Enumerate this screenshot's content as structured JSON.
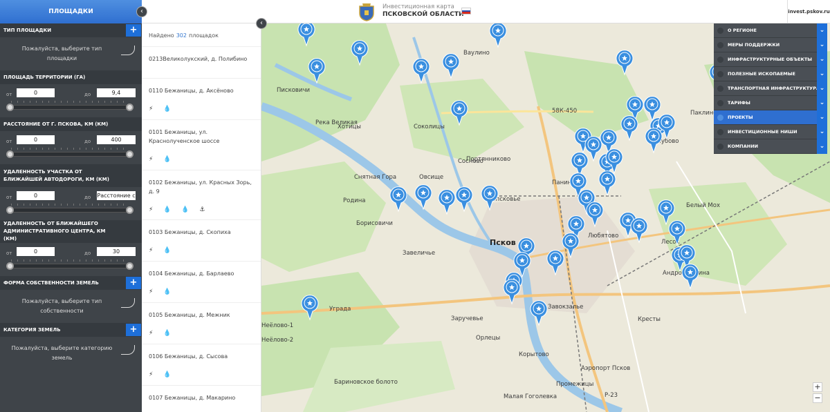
{
  "sidebar": {
    "title": "ПЛОЩАДКИ",
    "collapse_icon": "‹",
    "sections": [
      {
        "title": "ТИП ПЛОЩАДКИ",
        "type": "select",
        "hint": "Пожалуйста, выберите тип площадки"
      },
      {
        "title": "ПЛОЩАДЬ ТЕРРИТОРИИ (ГА)",
        "type": "range",
        "from_label": "от",
        "to_label": "до",
        "from": "0",
        "to": "9,4"
      },
      {
        "title": "РАССТОЯНИЕ ОТ Г. ПСКОВА, КМ (КМ)",
        "type": "range",
        "from_label": "от",
        "to_label": "до",
        "from": "0",
        "to": "400"
      },
      {
        "title": "УДАЛЕННОСТЬ УЧАСТКА ОТ БЛИЖАЙШЕЙ АВТОДОРОГИ, КМ (КМ)",
        "type": "range",
        "from_label": "от",
        "to_label": "до",
        "from": "0",
        "to": "Расстояние с"
      },
      {
        "title": "УДАЛЕННОСТЬ ОТ БЛИЖАЙШЕГО АДМИНИСТРАТИВНОГО ЦЕНТРА, КМ (КМ)",
        "type": "range",
        "from_label": "от",
        "to_label": "до",
        "from": "0",
        "to": "30"
      },
      {
        "title": "ФОРМА СОБСТВЕННОСТИ ЗЕМЕЛЬ",
        "type": "select",
        "hint": "Пожалуйста, выберите тип собственности"
      },
      {
        "title": "КАТЕГОРИЯ ЗЕМЕЛЬ",
        "type": "select",
        "hint": "Пожалуйста, выберите категорию земель"
      }
    ]
  },
  "header": {
    "subtitle": "Инвестиционная карта",
    "title": "ПСКОВСКОЙ ОБЛАСТИ",
    "site": "invest.pskov.ru"
  },
  "list": {
    "found_prefix": "Найдено",
    "found_count": "302",
    "found_suffix": "площадок",
    "items": [
      {
        "title": "0213Великолукский, д. Полибино",
        "icons": ""
      },
      {
        "title": "0110 Бежаницы, д. Аксёново",
        "icons": "⚡ 💧"
      },
      {
        "title": "0101 Бежаницы, ул. Краснолученское шоссе",
        "icons": "⚡ 💧"
      },
      {
        "title": "0102 Бежаницы, ул. Красных Зорь, д. 9",
        "icons": "⚡ 💧 💧 ⚓"
      },
      {
        "title": "0103 Бежаницы, д. Скопиха",
        "icons": "⚡ 💧"
      },
      {
        "title": "0104 Бежаницы, д. Барлаево",
        "icons": "⚡ 💧"
      },
      {
        "title": "0105 Бежаницы, д. Межник",
        "icons": "⚡ 💧"
      },
      {
        "title": "0106 Бежаницы, д. Сысова",
        "icons": "⚡ 💧"
      },
      {
        "title": "0107 Бежаницы, д. Макарино",
        "icons": ""
      }
    ]
  },
  "layers": [
    {
      "label": "О РЕГИОНЕ",
      "active": false
    },
    {
      "label": "МЕРЫ ПОДДЕРЖКИ",
      "active": false
    },
    {
      "label": "ИНФРАСТРУКТУРНЫЕ ОБЪЕКТЫ",
      "active": false
    },
    {
      "label": "ПОЛЕЗНЫЕ ИСКОПАЕМЫЕ",
      "active": false
    },
    {
      "label": "ТРАНСПОРТНАЯ ИНФРАСТРУКТУРА",
      "active": false
    },
    {
      "label": "ТАРИФЫ",
      "active": false
    },
    {
      "label": "ПРОЕКТЫ",
      "active": true
    },
    {
      "label": "ИНВЕСТИЦИОННЫЕ НИШИ",
      "active": false
    },
    {
      "label": "КОМПАНИИ",
      "active": false
    }
  ],
  "map": {
    "zoom_in": "+",
    "zoom_out": "−",
    "place_labels": [
      "Ваулино",
      "Писковичи",
      "Хотицы",
      "Соколицы",
      "Портянниково",
      "Сосново",
      "Снятная Гора",
      "Овсище",
      "Родина",
      "Запсковье",
      "Панино",
      "Борисовичи",
      "Завеличье",
      "Псков",
      "Любятово",
      "Белый Мох",
      "Лесок",
      "Андроновщина",
      "Уграда",
      "Неёлово-1",
      "Неёлово-2",
      "Заручевье",
      "Орлецы",
      "Завокзалье",
      "Корытово",
      "Кресты",
      "Промежицы",
      "Малая Гоголевка",
      "Голубово",
      "Паклино",
      "Аэропорт Псков",
      "Река Великая",
      "Бариновское болото",
      "58К-450",
      "Р-23"
    ],
    "marker_count": 46
  },
  "colors": {
    "accent": "#1e6fd9",
    "sidebar": "#3f4449",
    "marker": "#3a8fe0"
  }
}
